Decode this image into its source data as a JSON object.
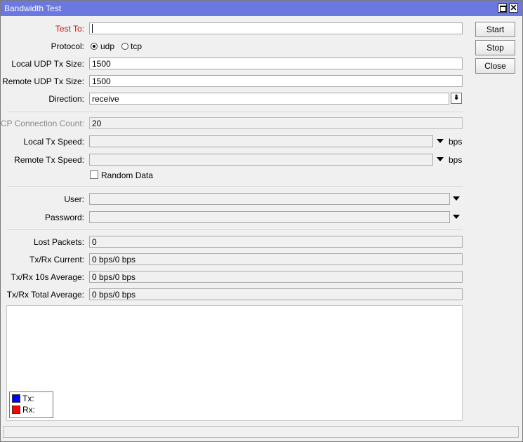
{
  "window": {
    "title": "Bandwidth Test"
  },
  "title_buttons": {
    "maximize": "",
    "close": "✕"
  },
  "form": {
    "test_to": {
      "label": "Test To:",
      "value": ""
    },
    "protocol": {
      "label": "Protocol:",
      "options": [
        "udp",
        "tcp"
      ],
      "selected": "udp"
    },
    "local_udp_tx_size": {
      "label": "Local UDP Tx Size:",
      "value": "1500"
    },
    "remote_udp_tx_size": {
      "label": "Remote UDP Tx Size:",
      "value": "1500"
    },
    "direction": {
      "label": "Direction:",
      "value": "receive"
    },
    "tcp_connection_count": {
      "label": "TCP Connection Count:",
      "value": "20"
    },
    "local_tx_speed": {
      "label": "Local Tx Speed:",
      "value": "",
      "unit": "bps"
    },
    "remote_tx_speed": {
      "label": "Remote Tx Speed:",
      "value": "",
      "unit": "bps"
    },
    "random_data": {
      "label": "Random Data",
      "checked": false
    },
    "user": {
      "label": "User:",
      "value": ""
    },
    "password": {
      "label": "Password:",
      "value": ""
    }
  },
  "stats": {
    "lost_packets": {
      "label": "Lost Packets:",
      "value": "0"
    },
    "txrx_current": {
      "label": "Tx/Rx Current:",
      "value": "0 bps/0 bps"
    },
    "txrx_10s_average": {
      "label": "Tx/Rx 10s Average:",
      "value": "0 bps/0 bps"
    },
    "txrx_total_average": {
      "label": "Tx/Rx Total Average:",
      "value": "0 bps/0 bps"
    }
  },
  "buttons": {
    "start": "Start",
    "stop": "Stop",
    "close": "Close"
  },
  "legend": {
    "tx": {
      "label": "Tx:",
      "color": "#0000ff"
    },
    "rx": {
      "label": "Rx:",
      "color": "#ff0000"
    }
  },
  "status_bar": {
    "text": ""
  }
}
